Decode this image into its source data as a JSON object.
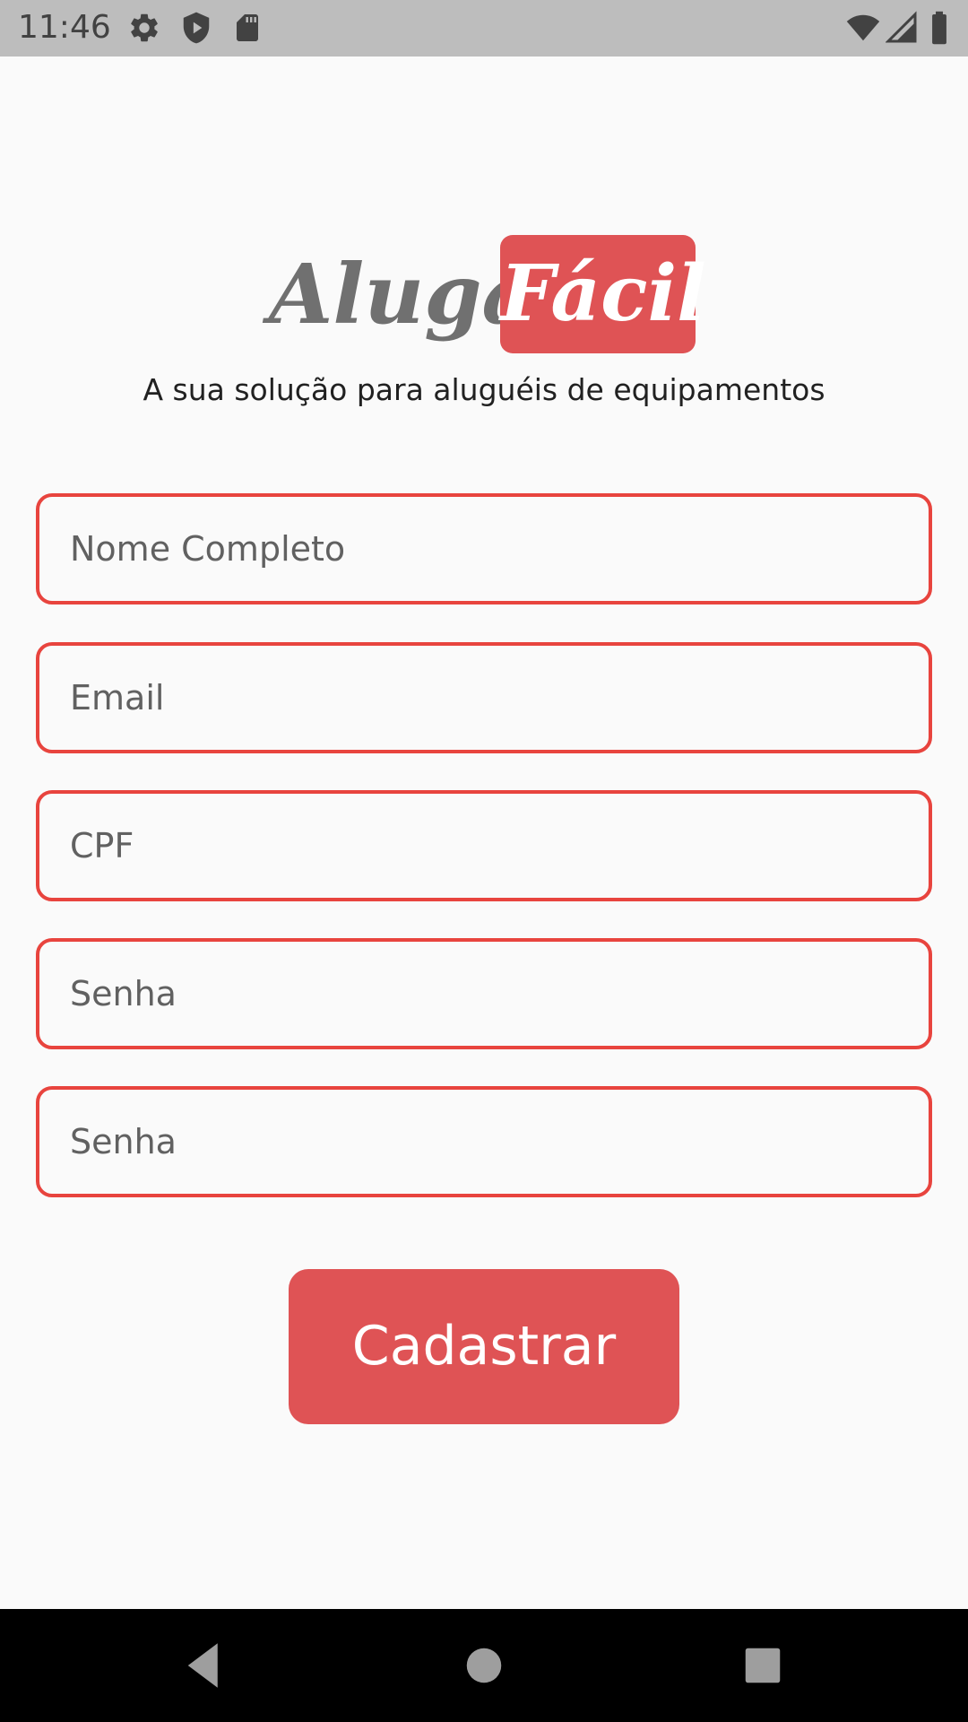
{
  "status_bar": {
    "time": "11:46",
    "left_icons": [
      "gear-icon",
      "shield-play-icon",
      "sd-card-icon"
    ],
    "right_icons": [
      "wifi-icon",
      "signal-icon",
      "battery-icon"
    ]
  },
  "logo": {
    "word_1": "Aluga",
    "word_2": "Fácil"
  },
  "tagline": "A sua solução para aluguéis de equipamentos",
  "form": {
    "fields": [
      {
        "placeholder": "Nome Completo",
        "value": ""
      },
      {
        "placeholder": "Email",
        "value": ""
      },
      {
        "placeholder": "CPF",
        "value": ""
      },
      {
        "placeholder": "Senha",
        "value": ""
      },
      {
        "placeholder": "Senha",
        "value": ""
      }
    ],
    "submit_label": "Cadastrar"
  },
  "nav_bar": {
    "buttons": [
      "back-icon",
      "home-icon",
      "recents-icon"
    ]
  },
  "colors": {
    "accent": "#DF5355",
    "field_border": "#E8443E",
    "logo_gray": "#707070",
    "background": "#FAFAFA",
    "status_bar": "#BDBDBD",
    "nav_bar": "#000000"
  }
}
